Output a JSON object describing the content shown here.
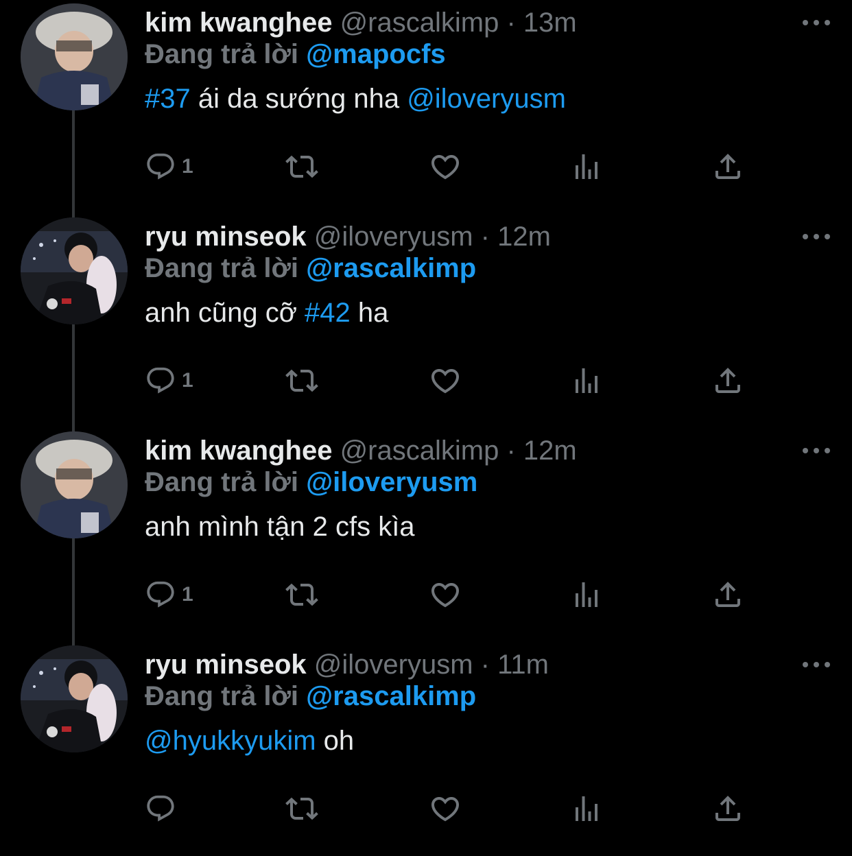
{
  "colors": {
    "background": "#000000",
    "primary_text": "#e7e9ea",
    "secondary_text": "#71767b",
    "accent": "#1d9bf0",
    "thread_line": "#333639"
  },
  "tweets": [
    {
      "display_name": "kim kwanghee",
      "handle": "@rascalkimp",
      "separator": "·",
      "time": "13m",
      "reply_prefix": "Đang trả lời",
      "reply_to": "@mapocfs",
      "body": [
        {
          "text": "#37",
          "link": true
        },
        {
          "text": " ái da sướng nha ",
          "link": false
        },
        {
          "text": "@iloveryusm",
          "link": true
        }
      ],
      "reply_count": "1",
      "avatar_icon": "avatar-photo"
    },
    {
      "display_name": "ryu minseok",
      "handle": "@iloveryusm",
      "separator": "·",
      "time": "12m",
      "reply_prefix": "Đang trả lời",
      "reply_to": "@rascalkimp",
      "body": [
        {
          "text": "anh cũng cỡ ",
          "link": false
        },
        {
          "text": "#42",
          "link": true
        },
        {
          "text": " ha",
          "link": false
        }
      ],
      "reply_count": "1",
      "avatar_icon": "avatar-photo"
    },
    {
      "display_name": "kim kwanghee",
      "handle": "@rascalkimp",
      "separator": "·",
      "time": "12m",
      "reply_prefix": "Đang trả lời",
      "reply_to": "@iloveryusm",
      "body": [
        {
          "text": "anh mình tận 2 cfs kìa",
          "link": false
        }
      ],
      "reply_count": "1",
      "avatar_icon": "avatar-photo"
    },
    {
      "display_name": "ryu minseok",
      "handle": "@iloveryusm",
      "separator": "·",
      "time": "11m",
      "reply_prefix": "Đang trả lời",
      "reply_to": "@rascalkimp",
      "body": [
        {
          "text": "@hyukkyukim",
          "link": true
        },
        {
          "text": " oh",
          "link": false
        }
      ],
      "reply_count": "",
      "avatar_icon": "avatar-photo"
    }
  ],
  "icons": {
    "reply": "reply-icon",
    "retweet": "retweet-icon",
    "like": "like-icon",
    "views": "views-icon",
    "share": "share-icon",
    "more": "more-icon"
  }
}
